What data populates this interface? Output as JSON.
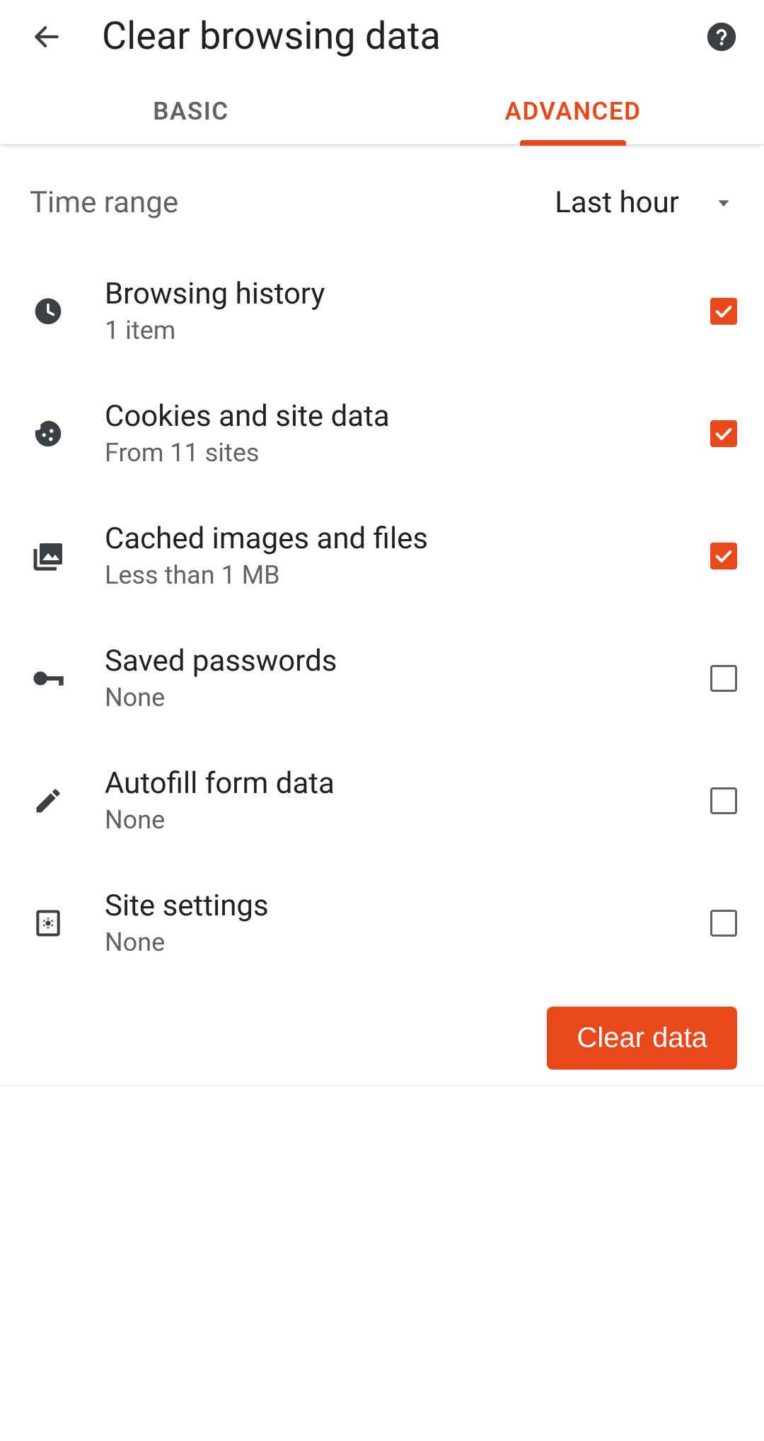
{
  "colors": {
    "accent": "#e8491c"
  },
  "header": {
    "title": "Clear browsing data"
  },
  "tabs": {
    "basic": "BASIC",
    "advanced": "ADVANCED",
    "active": "advanced"
  },
  "time_range": {
    "label": "Time range",
    "value": "Last hour"
  },
  "items": {
    "history": {
      "title": "Browsing history",
      "sub": "1 item",
      "checked": true
    },
    "cookies": {
      "title": "Cookies and site data",
      "sub": "From 11 sites",
      "checked": true
    },
    "cache": {
      "title": "Cached images and files",
      "sub": "Less than 1 MB",
      "checked": true
    },
    "passwords": {
      "title": "Saved passwords",
      "sub": "None",
      "checked": false
    },
    "autofill": {
      "title": "Autofill form data",
      "sub": "None",
      "checked": false
    },
    "site": {
      "title": "Site settings",
      "sub": "None",
      "checked": false
    }
  },
  "footer": {
    "clear": "Clear data"
  }
}
